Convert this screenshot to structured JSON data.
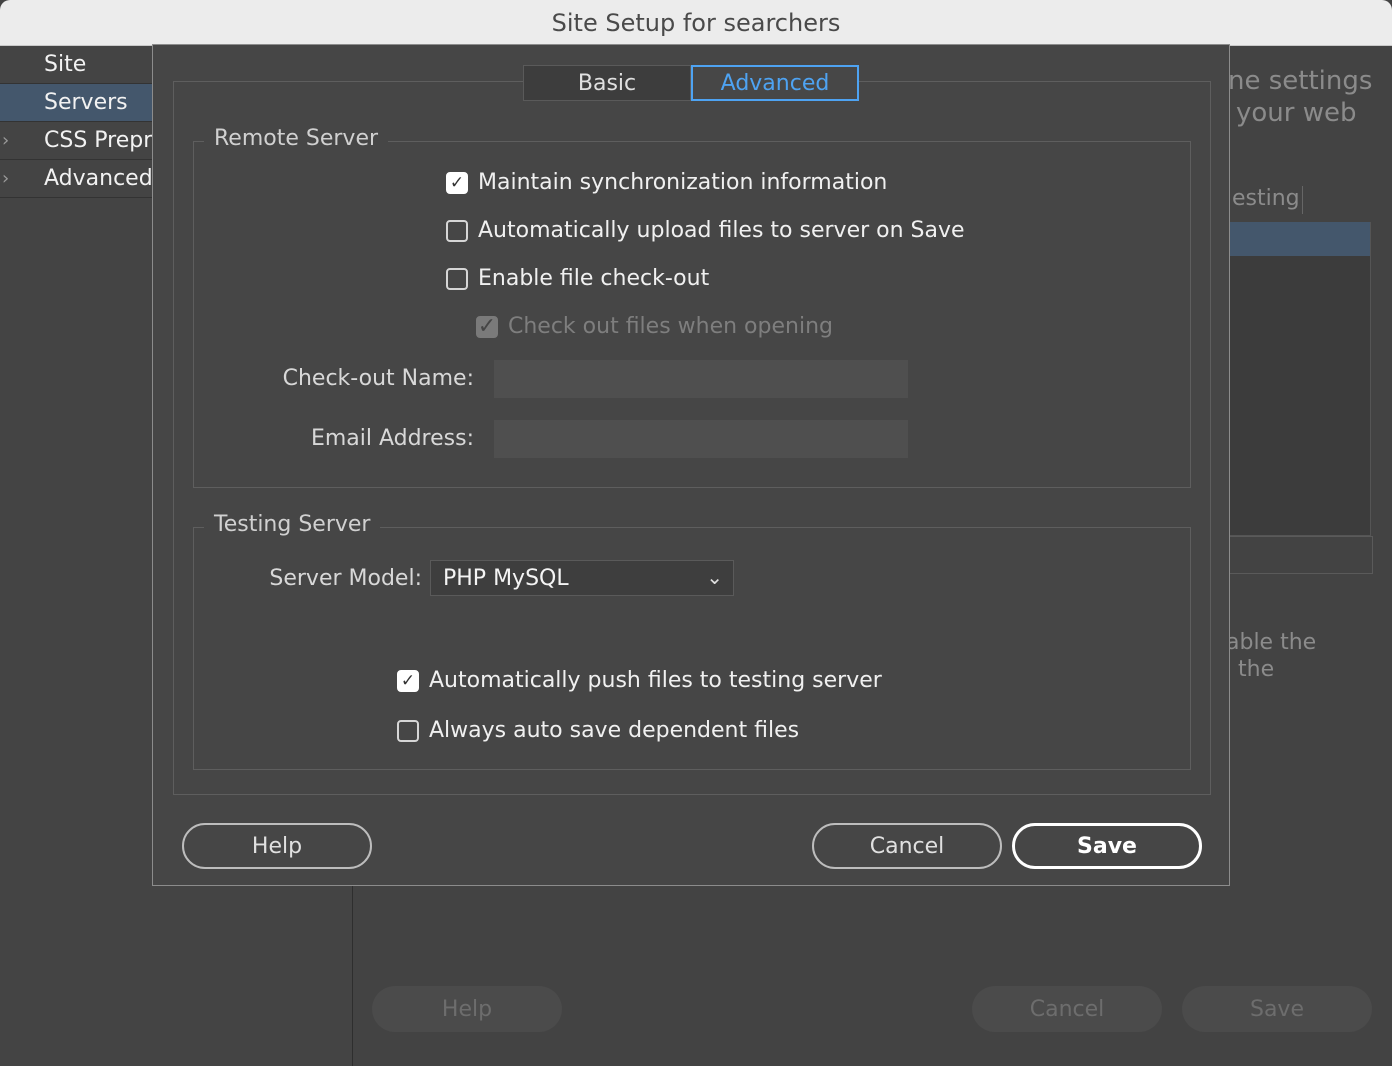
{
  "window": {
    "title": "Site Setup for searchers"
  },
  "sidebar": {
    "items": [
      {
        "label": "Site",
        "selected": false,
        "expandable": false
      },
      {
        "label": "Servers",
        "selected": true,
        "expandable": false
      },
      {
        "label": "CSS Preprc",
        "selected": false,
        "expandable": true
      },
      {
        "label": "Advanced",
        "selected": false,
        "expandable": true
      }
    ]
  },
  "background": {
    "line1": "ne settings",
    "line2": "your web",
    "tab_fragment": "esting",
    "desc_line1": "able the",
    "desc_line2": "the",
    "help_label": "Help",
    "cancel_label": "Cancel",
    "save_label": "Save"
  },
  "dialog": {
    "tabs": [
      {
        "label": "Basic",
        "active": false
      },
      {
        "label": "Advanced",
        "active": true
      }
    ],
    "remote_server": {
      "legend": "Remote Server",
      "maintain_sync": {
        "label": "Maintain synchronization information",
        "checked": true
      },
      "auto_upload": {
        "label": "Automatically upload files to server on Save",
        "checked": false
      },
      "enable_checkout": {
        "label": "Enable file check-out",
        "checked": false
      },
      "checkout_when_opening": {
        "label": "Check out files when opening",
        "checked": true,
        "disabled": true
      },
      "checkout_name": {
        "label": "Check-out Name:",
        "value": ""
      },
      "email_address": {
        "label": "Email Address:",
        "value": ""
      }
    },
    "testing_server": {
      "legend": "Testing Server",
      "server_model": {
        "label": "Server Model:",
        "value": "PHP MySQL"
      },
      "auto_push": {
        "label": "Automatically push files to testing server",
        "checked": true
      },
      "auto_save_dependent": {
        "label": "Always auto save dependent files",
        "checked": false
      }
    },
    "buttons": {
      "help": "Help",
      "cancel": "Cancel",
      "save": "Save"
    }
  },
  "icons": {
    "check": "✓",
    "chevron_down": "⌄",
    "chevron_right": "›"
  },
  "colors": {
    "accent": "#4ea3f2",
    "selection": "#44576c",
    "background": "#434343"
  }
}
